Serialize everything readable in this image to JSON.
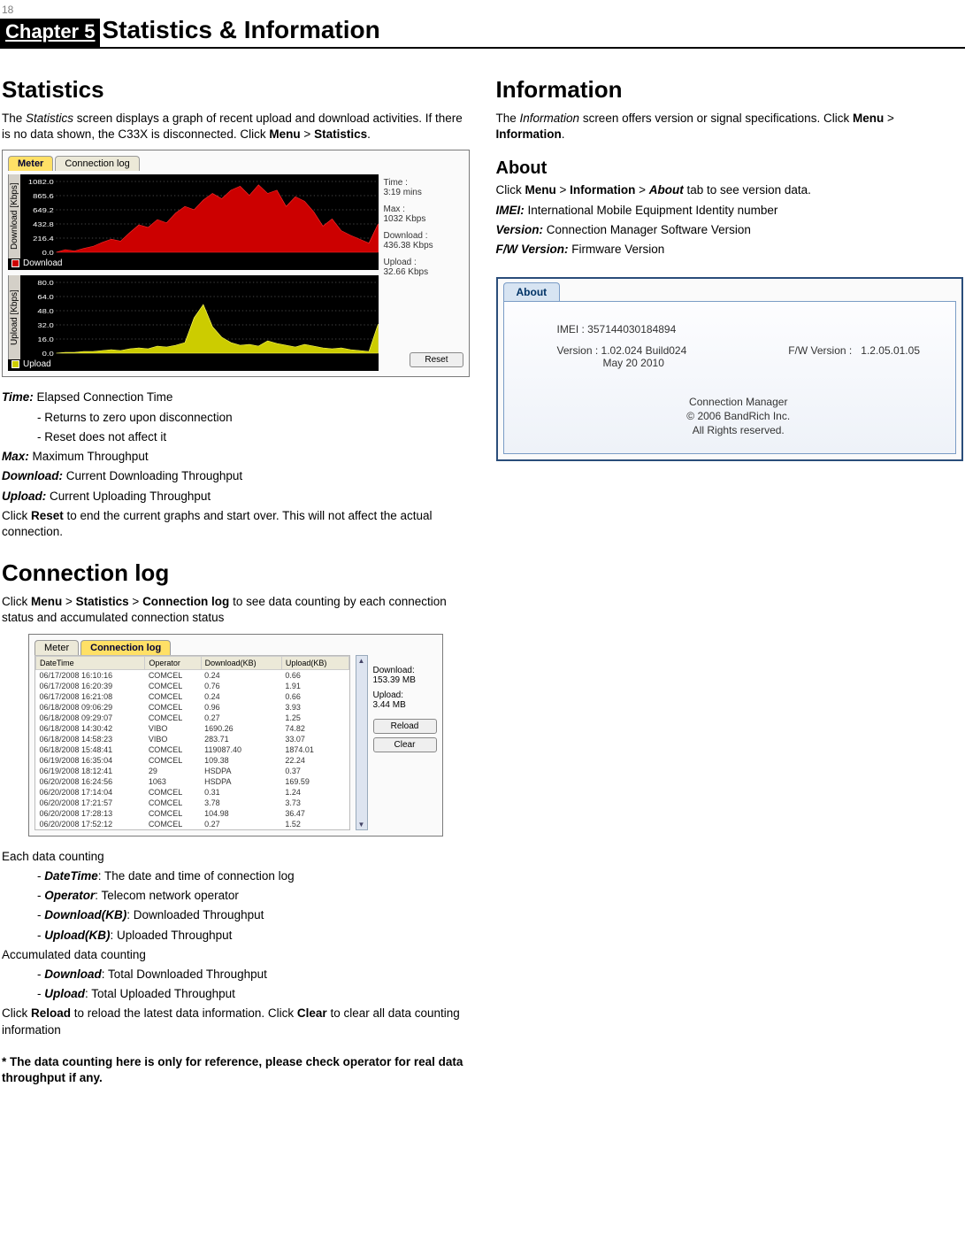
{
  "page_number": "18",
  "chapter_label": "Chapter 5",
  "chapter_title": "Statistics & Information",
  "statistics": {
    "heading": "Statistics",
    "intro_pre": "The ",
    "intro_em": "Statistics",
    "intro_post": " screen displays a graph of recent upload and download activities. If there is no data shown, the C33X is disconnected. Click ",
    "intro_menu": "Menu",
    "intro_gt": " > ",
    "intro_stats": "Statistics",
    "intro_end": ".",
    "time_label": "Time:",
    "time_desc": " Elapsed Connection Time",
    "time_b1": "- Returns to zero upon disconnection",
    "time_b2": "- Reset does not affect it",
    "max_label": "Max:",
    "max_desc": " Maximum Throughput",
    "dl_label": "Download:",
    "dl_desc": " Current Downloading Throughput",
    "ul_label": "Upload:",
    "ul_desc": " Current Uploading Throughput",
    "reset_pre": "Click ",
    "reset_btn": "Reset",
    "reset_post": " to end the current graphs and start over. This will not affect the actual connection."
  },
  "stats_fig": {
    "tab_meter": "Meter",
    "tab_log": "Connection log",
    "dl_axis": "Download [Kbps]",
    "ul_axis": "Upload [Kbps]",
    "dl_ticks": [
      "1082.0",
      "865.6",
      "649.2",
      "432.8",
      "216.4",
      "0.0"
    ],
    "ul_ticks": [
      "80.0",
      "64.0",
      "48.0",
      "32.0",
      "16.0",
      "0.0"
    ],
    "dl_legend": "Download",
    "ul_legend": "Upload",
    "time_lbl": "Time :",
    "time_val": "3:19 mins",
    "max_lbl": "Max :",
    "max_val": "1032 Kbps",
    "sdl_lbl": "Download :",
    "sdl_val": "436.38 Kbps",
    "sul_lbl": "Upload :",
    "sul_val": "32.66 Kbps",
    "reset": "Reset"
  },
  "connlog": {
    "heading": "Connection log",
    "intro_pre": "Click ",
    "m": "Menu",
    "gt1": " > ",
    "s": "Statistics",
    "gt2": " > ",
    "c": "Connection log",
    "intro_post": " to see data counting by each connection status and accumulated connection status",
    "each_head": "Each data counting",
    "b1_pre": "- ",
    "b1_em": "DateTime",
    "b1_post": ": The date and time of connection log",
    "b2_pre": "- ",
    "b2_em": "Operator",
    "b2_post": ": Telecom network operator",
    "b3_pre": "- ",
    "b3_em": "Download(KB)",
    "b3_post": ": Downloaded Throughput",
    "b4_pre": "- ",
    "b4_em": "Upload(KB)",
    "b4_post": ": Uploaded Throughput",
    "acc_head": "Accumulated data counting",
    "a1_pre": "- ",
    "a1_em": "Download",
    "a1_post": ": Total Downloaded Throughput",
    "a2_pre": "- ",
    "a2_em": "Upload",
    "a2_post": ": Total Uploaded Throughput",
    "tail_pre": "Click ",
    "tail_r": "Reload",
    "tail_mid": " to reload the latest data information.    Click ",
    "tail_c": "Clear",
    "tail_post": " to clear all data counting information",
    "footnote": "* The data counting here is only for reference, please check operator for real data throughput if any."
  },
  "log_fig": {
    "tab_meter": "Meter",
    "tab_log": "Connection log",
    "cols": [
      "DateTime",
      "Operator",
      "Download(KB)",
      "Upload(KB)"
    ],
    "rows": [
      [
        "06/17/2008 16:10:16",
        "COMCEL",
        "0.24",
        "0.66"
      ],
      [
        "06/17/2008 16:20:39",
        "COMCEL",
        "0.76",
        "1.91"
      ],
      [
        "06/17/2008 16:21:08",
        "COMCEL",
        "0.24",
        "0.66"
      ],
      [
        "06/18/2008 09:06:29",
        "COMCEL",
        "0.96",
        "3.93"
      ],
      [
        "06/18/2008 09:29:07",
        "COMCEL",
        "0.27",
        "1.25"
      ],
      [
        "06/18/2008 14:30:42",
        "VIBO",
        "1690.26",
        "74.82"
      ],
      [
        "06/18/2008 14:58:23",
        "VIBO",
        "283.71",
        "33.07"
      ],
      [
        "06/18/2008 15:48:41",
        "COMCEL",
        "119087.40",
        "1874.01"
      ],
      [
        "06/19/2008 16:35:04",
        "COMCEL",
        "109.38",
        "22.24"
      ],
      [
        "06/19/2008 18:12:41",
        "29",
        "HSDPA",
        "0.37"
      ],
      [
        "06/20/2008 16:24:56",
        "1063",
        "HSDPA",
        "169.59"
      ],
      [
        "06/20/2008 17:14:04",
        "COMCEL",
        "0.31",
        "1.24"
      ],
      [
        "06/20/2008 17:21:57",
        "COMCEL",
        "3.78",
        "3.73"
      ],
      [
        "06/20/2008 17:28:13",
        "COMCEL",
        "104.98",
        "36.47"
      ],
      [
        "06/20/2008 17:52:12",
        "COMCEL",
        "0.27",
        "1.52"
      ]
    ],
    "side_dl_lbl": "Download:",
    "side_dl_val": "153.39 MB",
    "side_ul_lbl": "Upload:",
    "side_ul_val": "3.44 MB",
    "reload": "Reload",
    "clear": "Clear"
  },
  "information": {
    "heading": "Information",
    "intro_pre": "The ",
    "intro_em": "Information",
    "intro_post": " screen offers version or signal specifications. Click ",
    "m": "Menu",
    "gt": " > ",
    "i": "Information",
    "end": "."
  },
  "about": {
    "heading": "About",
    "line_pre": "Click ",
    "m": "Menu",
    "gt1": " > ",
    "i": "Information",
    "gt2": " > ",
    "a": "About",
    "line_post": " tab to see version data.",
    "imei_lbl": "IMEI:",
    "imei_desc": " International Mobile Equipment Identity number",
    "ver_lbl": "Version:",
    "ver_desc": " Connection Manager Software Version",
    "fw_lbl": "F/W Version:",
    "fw_desc": " Firmware Version"
  },
  "about_fig": {
    "tab": "About",
    "imei": "IMEI : 357144030184894",
    "ver_lbl": "Version : ",
    "ver_val": "1.02.024 Build024",
    "ver_date": "May 20 2010",
    "fw_lbl": "F/W Version :",
    "fw_val": "1.2.05.01.05",
    "foot1": "Connection Manager",
    "foot2": "© 2006 BandRich Inc.",
    "foot3": "All Rights reserved."
  },
  "chart_data": [
    {
      "type": "area",
      "title": "Download",
      "ylabel": "Download [Kbps]",
      "ylim": [
        0,
        1082
      ],
      "x": [
        0,
        1,
        2,
        3,
        4,
        5,
        6,
        7,
        8,
        9,
        10,
        11,
        12,
        13,
        14,
        15,
        16,
        17,
        18,
        19,
        20,
        21,
        22,
        23,
        24,
        25,
        26,
        27,
        28,
        29,
        30,
        31,
        32,
        33,
        34,
        35
      ],
      "values": [
        0,
        40,
        20,
        60,
        90,
        150,
        200,
        170,
        300,
        420,
        380,
        500,
        450,
        600,
        700,
        650,
        800,
        900,
        820,
        950,
        1010,
        870,
        1030,
        900,
        950,
        700,
        850,
        780,
        620,
        400,
        510,
        330,
        260,
        200,
        140,
        436
      ],
      "color": "#ff0000"
    },
    {
      "type": "area",
      "title": "Upload",
      "ylabel": "Upload [Kbps]",
      "ylim": [
        0,
        80
      ],
      "x": [
        0,
        1,
        2,
        3,
        4,
        5,
        6,
        7,
        8,
        9,
        10,
        11,
        12,
        13,
        14,
        15,
        16,
        17,
        18,
        19,
        20,
        21,
        22,
        23,
        24,
        25,
        26,
        27,
        28,
        29,
        30,
        31,
        32,
        33,
        34,
        35
      ],
      "values": [
        0,
        1,
        1,
        2,
        2,
        3,
        4,
        3,
        5,
        6,
        5,
        8,
        7,
        9,
        12,
        40,
        55,
        30,
        18,
        12,
        9,
        10,
        8,
        14,
        11,
        9,
        7,
        10,
        8,
        6,
        5,
        6,
        4,
        3,
        2,
        33
      ],
      "color": "#ffff00"
    }
  ]
}
